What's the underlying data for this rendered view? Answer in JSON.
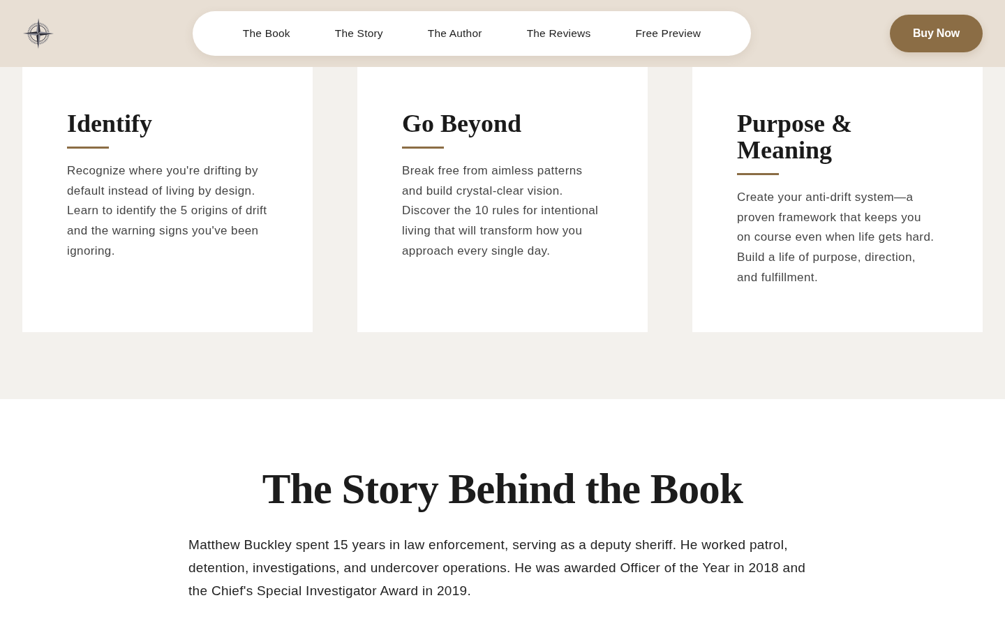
{
  "header": {
    "nav": [
      {
        "label": "The Book"
      },
      {
        "label": "The Story"
      },
      {
        "label": "The Author"
      },
      {
        "label": "The Reviews"
      },
      {
        "label": "Free Preview"
      }
    ],
    "cta": "Buy Now"
  },
  "features": [
    {
      "title": "Identify",
      "text": "Recognize where you're drifting by default instead of living by design. Learn to identify the 5 origins of drift and the warning signs you've been ignoring."
    },
    {
      "title": "Go Beyond",
      "text": "Break free from aimless patterns and build crystal-clear vision. Discover the 10 rules for intentional living that will transform how you approach every single day."
    },
    {
      "title": "Purpose & Meaning",
      "text": "Create your anti-drift system—a proven framework that keeps you on course even when life gets hard. Build a life of purpose, direction, and fulfillment."
    }
  ],
  "story": {
    "title": "The Story Behind the Book",
    "text": "Matthew Buckley spent 15 years in law enforcement, serving as a deputy sheriff. He worked patrol, detention, investigations, and undercover operations. He was awarded Officer of the Year in 2018 and the Chief's Special Investigator Award in 2019."
  }
}
